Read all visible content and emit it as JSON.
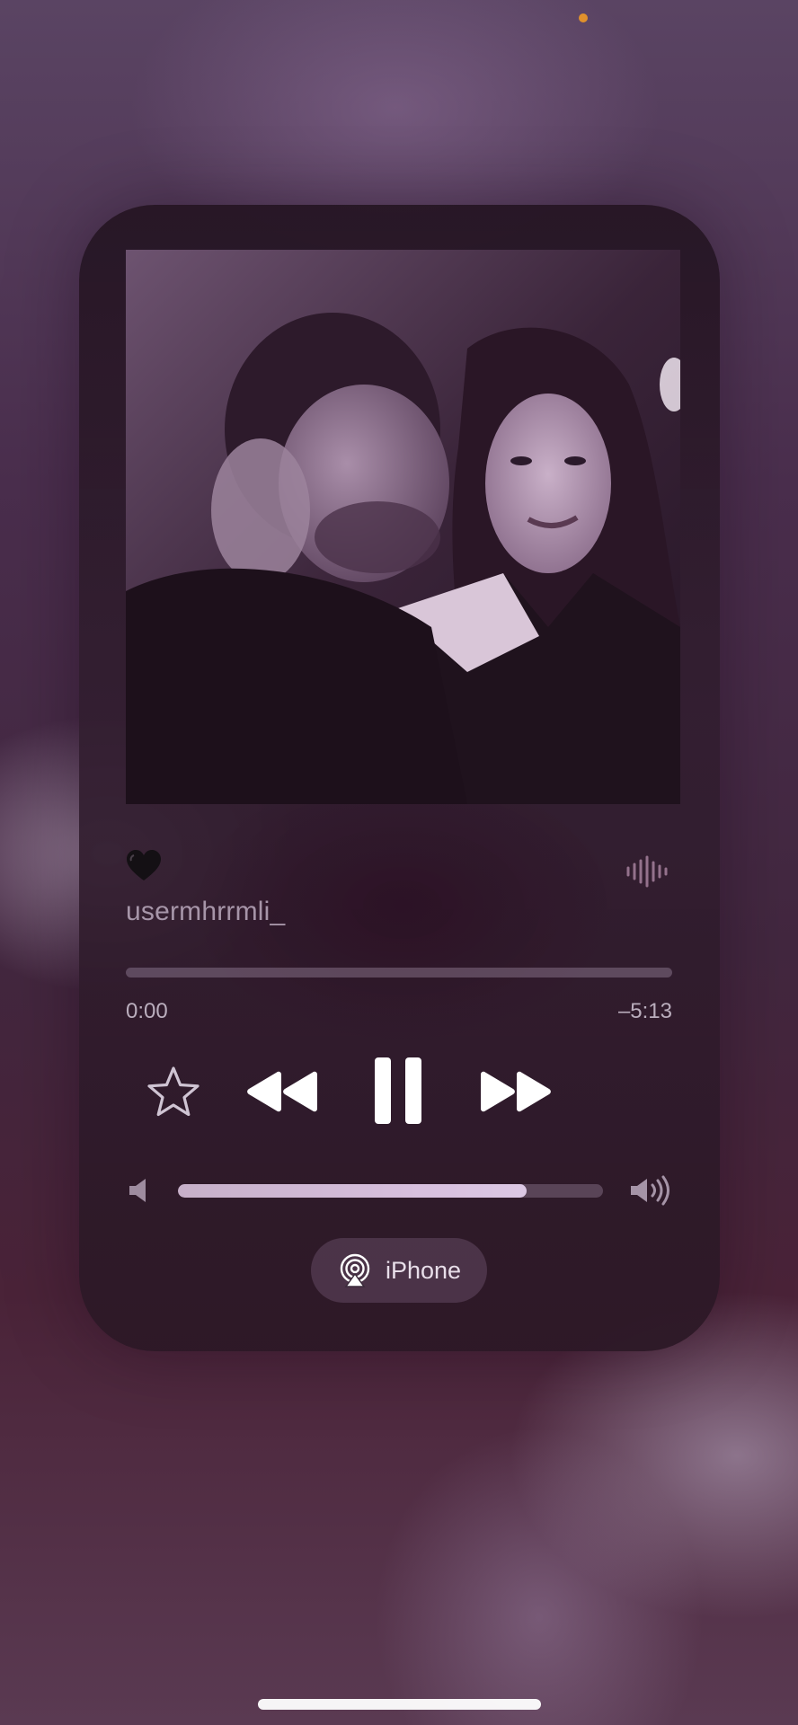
{
  "status_bar": {
    "indicator_color": "#e0912c"
  },
  "now_playing": {
    "artwork": {
      "description_icon": "album-artwork-icon"
    },
    "title_emoji": "🖤",
    "artist": "usermhrrmli_",
    "progress": {
      "elapsed": "0:00",
      "remaining": "–5:13",
      "fraction": 0.0
    },
    "controls": {
      "favorite_icon": "star-icon",
      "rewind_icon": "rewind-icon",
      "pause_icon": "pause-icon",
      "forward_icon": "fast-forward-icon"
    },
    "volume": {
      "level": 0.82,
      "low_icon": "speaker-low-icon",
      "high_icon": "speaker-high-icon"
    },
    "output": {
      "label": "iPhone",
      "icon": "airplay-icon"
    }
  },
  "colors": {
    "accent": "#d8c0de",
    "card": "#2e1c2c",
    "text": "#ffffff"
  }
}
